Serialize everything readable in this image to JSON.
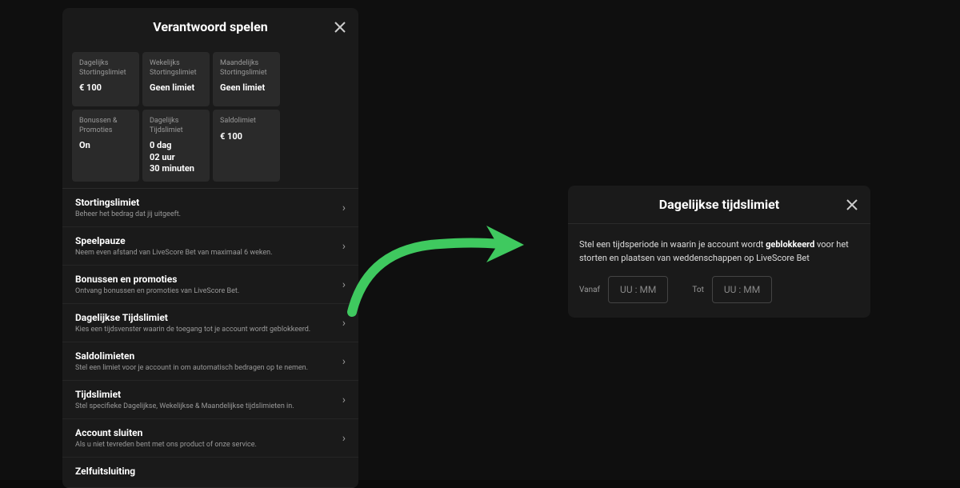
{
  "modalLeft": {
    "title": "Verantwoord spelen",
    "cards": [
      {
        "label": "Dagelijks\nStortingslimiet",
        "value": "€ 100"
      },
      {
        "label": "Wekelijks\nStortingslimiet",
        "value": "Geen limiet"
      },
      {
        "label": "Maandelijks\nStortingslimiet",
        "value": "Geen limiet"
      },
      {
        "label": "Bonussen &\nPromoties",
        "value": "On"
      },
      {
        "label": "Dagelijks\nTijdslimiet",
        "value": "0 dag\n02 uur\n30 minuten"
      },
      {
        "label": "Saldolimiet",
        "value": "€ 100"
      }
    ],
    "sections": [
      {
        "title": "Stortingslimiet",
        "desc": "Beheer het bedrag dat jij uitgeeft."
      },
      {
        "title": "Speelpauze",
        "desc": "Neem even afstand van LiveScore Bet van maximaal 6 weken."
      },
      {
        "title": "Bonussen en promoties",
        "desc": "Ontvang bonussen en promoties van LiveScore Bet."
      },
      {
        "title": "Dagelijkse Tijdslimiet",
        "desc": "Kies een tijdsvenster waarin de toegang tot je account wordt geblokkeerd."
      },
      {
        "title": "Saldolimieten",
        "desc": "Stel een limiet voor je account in om automatisch bedragen op te nemen."
      },
      {
        "title": "Tijdslimiet",
        "desc": "Stel specifieke Dagelijkse, Wekelijkse & Maandelijkse tijdslimieten in."
      },
      {
        "title": "Account sluiten",
        "desc": "Als u niet tevreden bent met ons product of onze service."
      },
      {
        "title": "Zelfuitsluiting",
        "desc": ""
      }
    ]
  },
  "modalRight": {
    "title": "Dagelijkse tijdslimiet",
    "instructionPre": "Stel een tijdsperiode in waarin je account wordt ",
    "instructionBold": "geblokkeerd",
    "instructionPost": " voor het storten en plaatsen van weddenschappen op LiveScore Bet",
    "from": {
      "label": "Vanaf",
      "placeholder": "UU : MM"
    },
    "to": {
      "label": "Tot",
      "placeholder": "UU : MM"
    }
  }
}
